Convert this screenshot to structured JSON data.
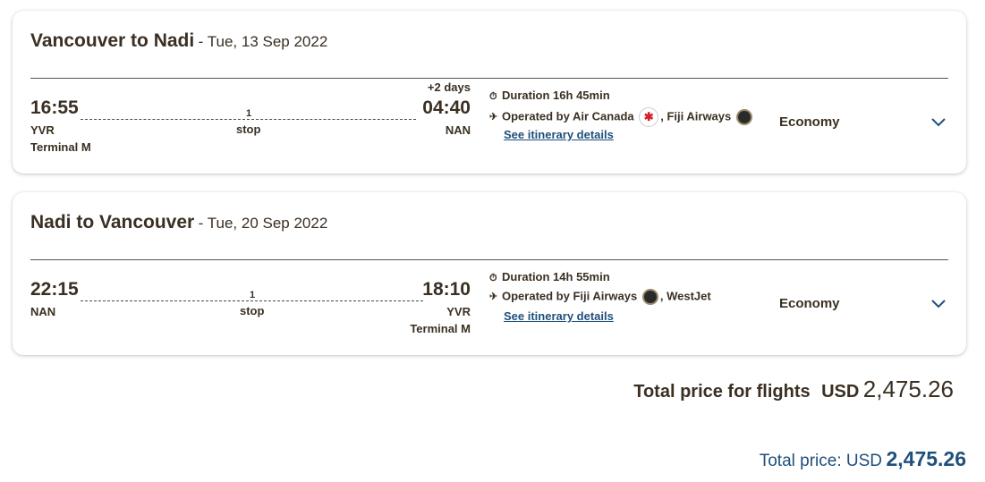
{
  "flights": [
    {
      "title": "Vancouver to Nadi",
      "date": "- Tue, 13 Sep 2022",
      "depart_time": "16:55",
      "depart_code": "YVR",
      "depart_terminal": "Terminal M",
      "arrive_time": "04:40",
      "arrive_code": "NAN",
      "arrive_terminal": "",
      "plus_days": "+2 days",
      "stops": "1",
      "stops_label": "stop",
      "duration": "Duration 16h 45min",
      "operated_prefix": "Operated by Air Canada",
      "operated_second": ", Fiji Airways",
      "details_link": "See itinerary details",
      "cabin": "Economy"
    },
    {
      "title": "Nadi to Vancouver",
      "date": "- Tue, 20 Sep 2022",
      "depart_time": "22:15",
      "depart_code": "NAN",
      "depart_terminal": "",
      "arrive_time": "18:10",
      "arrive_code": "YVR",
      "arrive_terminal": "Terminal M",
      "plus_days": "",
      "stops": "1",
      "stops_label": "stop",
      "duration": "Duration 14h 55min",
      "operated_prefix": "Operated by Fiji Airways",
      "operated_second": ", WestJet",
      "details_link": "See itinerary details",
      "cabin": "Economy"
    }
  ],
  "summary": {
    "total_label": "Total price for flights",
    "total_currency": "USD",
    "total_amount": "2,475.26",
    "footer_label": "Total price: USD",
    "footer_amount": "2,475.26"
  },
  "icons": {
    "stopwatch": "stopwatch-icon",
    "plane": "plane-icon",
    "air_canada": "air-canada-logo",
    "fiji": "fiji-airways-logo",
    "chevron": "chevron-down-icon"
  },
  "colors": {
    "text": "#3a2f22",
    "link": "#1f4f7c",
    "air_canada_red": "#d41e2a"
  }
}
